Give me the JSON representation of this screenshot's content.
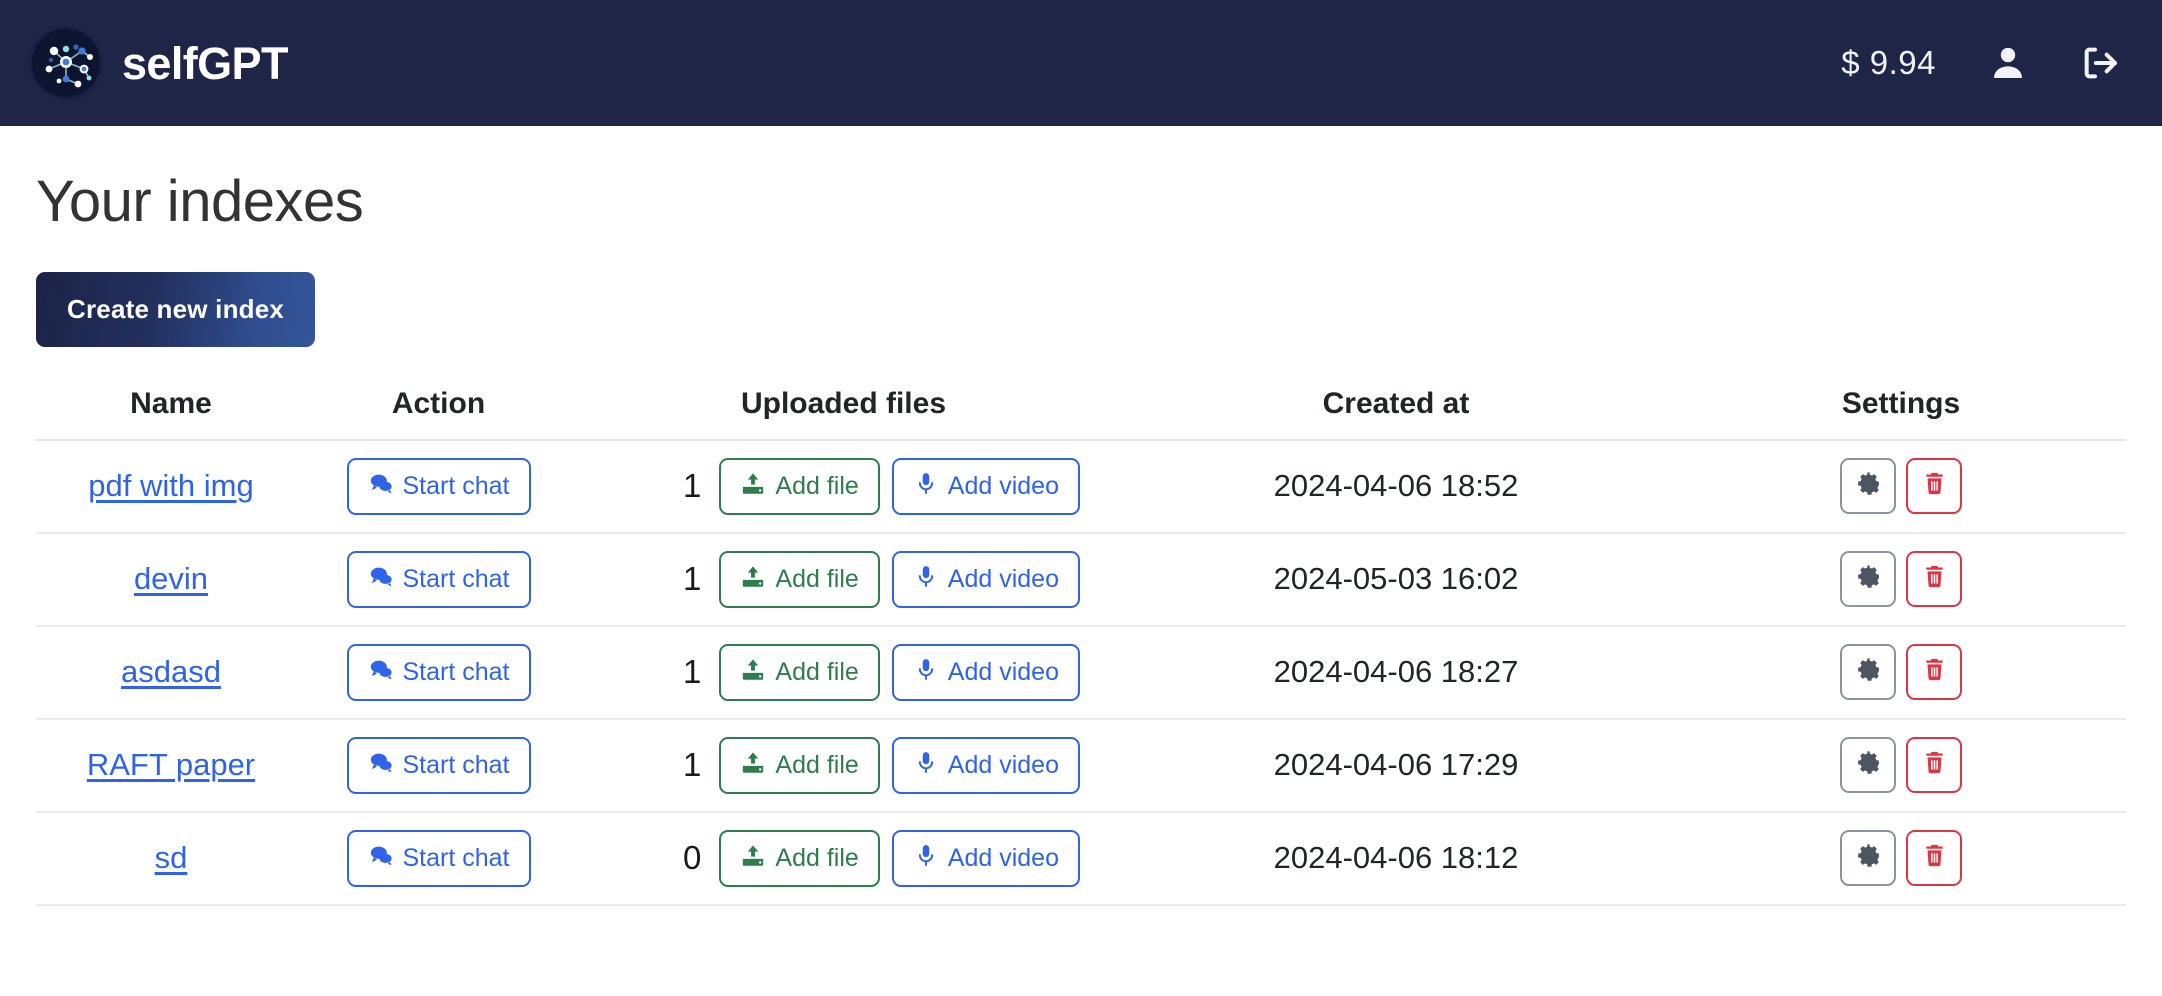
{
  "header": {
    "brand_name": "selfGPT",
    "logo_icon": "network-graph-logo",
    "balance": "$ 9.94",
    "account_icon": "user-icon",
    "logout_icon": "logout-icon",
    "background_color": "#1f2547"
  },
  "main": {
    "page_title": "Your indexes",
    "create_button_label": "Create new index",
    "create_button_gradient": [
      "#1b2347",
      "#34569b"
    ]
  },
  "table": {
    "columns": [
      "Name",
      "Action",
      "Uploaded files",
      "Created at",
      "Settings"
    ],
    "labels": {
      "start_chat": "Start chat",
      "add_file": "Add file",
      "add_video": "Add video",
      "chat_icon": "chat-bubbles-icon",
      "upload_icon": "upload-file-icon",
      "microphone_icon": "microphone-icon",
      "gear_icon": "gear-icon",
      "trash_icon": "trash-icon"
    },
    "colors": {
      "link": "#2f63e8",
      "add_file": "#2e7d4f",
      "add_video": "#2f63e8",
      "delete": "#dc3545",
      "gear_border": "#8d949e"
    },
    "rows": [
      {
        "name": "pdf with img",
        "files": "1",
        "created_at": "2024-04-06 18:52"
      },
      {
        "name": "devin",
        "files": "1",
        "created_at": "2024-05-03 16:02"
      },
      {
        "name": "asdasd",
        "files": "1",
        "created_at": "2024-04-06 18:27"
      },
      {
        "name": "RAFT paper",
        "files": "1",
        "created_at": "2024-04-06 17:29"
      },
      {
        "name": "sd",
        "files": "0",
        "created_at": "2024-04-06 18:12"
      }
    ]
  }
}
